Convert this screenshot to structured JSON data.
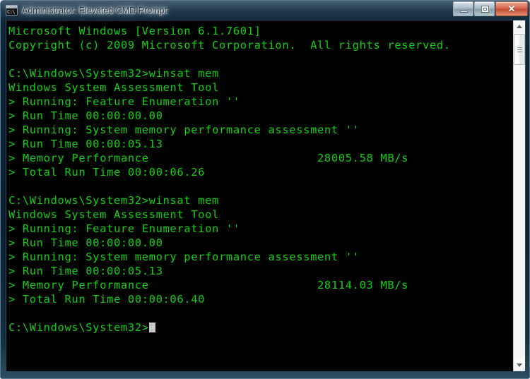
{
  "window": {
    "title": "Administrator: Elevated CMD Prompt",
    "icon": "cmd-console-icon",
    "icon_text": "C:\\",
    "colors": {
      "console_background": "#000000",
      "console_text": "#12d012",
      "titlebar": "#0a1f2e",
      "close_button": "#bf3d20",
      "cursor": "#c8c8c8"
    }
  },
  "controls": {
    "minimize_label": "–",
    "restore_label": "❐",
    "close_label": "✕"
  },
  "scrollbar": {
    "up_arrow": "scroll-up-arrow",
    "down_arrow": "scroll-down-arrow",
    "thumb": "scroll-thumb"
  },
  "console": {
    "prompt": "C:\\Windows\\System32>",
    "command": "winsat mem",
    "cursor": "█",
    "lines": [
      {
        "id": 0,
        "text": "Microsoft Windows [Version 6.1.7601]"
      },
      {
        "id": 1,
        "text": "Copyright (c) 2009 Microsoft Corporation.  All rights reserved."
      },
      {
        "id": 2,
        "text": ""
      },
      {
        "id": 3,
        "text": "C:\\Windows\\System32>winsat mem"
      },
      {
        "id": 4,
        "text": "Windows System Assessment Tool"
      },
      {
        "id": 5,
        "text": "> Running: Feature Enumeration ''"
      },
      {
        "id": 6,
        "text": "> Run Time 00:00:00.00"
      },
      {
        "id": 7,
        "text": "> Running: System memory performance assessment ''"
      },
      {
        "id": 8,
        "text": "> Run Time 00:00:05.13"
      },
      {
        "id": 9,
        "text": "> Memory Performance                        28005.58 MB/s"
      },
      {
        "id": 10,
        "text": "> Total Run Time 00:00:06.26"
      },
      {
        "id": 11,
        "text": ""
      },
      {
        "id": 12,
        "text": "C:\\Windows\\System32>winsat mem"
      },
      {
        "id": 13,
        "text": "Windows System Assessment Tool"
      },
      {
        "id": 14,
        "text": "> Running: Feature Enumeration ''"
      },
      {
        "id": 15,
        "text": "> Run Time 00:00:00.00"
      },
      {
        "id": 16,
        "text": "> Running: System memory performance assessment ''"
      },
      {
        "id": 17,
        "text": "> Run Time 00:00:05.13"
      },
      {
        "id": 18,
        "text": "> Memory Performance                        28114.03 MB/s"
      },
      {
        "id": 19,
        "text": "> Total Run Time 00:00:06.40"
      },
      {
        "id": 20,
        "text": ""
      },
      {
        "id": 21,
        "text": "C:\\Windows\\System32>"
      }
    ],
    "results": [
      {
        "run": 1,
        "tool": "Windows System Assessment Tool",
        "command": "winsat mem",
        "feature_enumeration_run_time": "00:00:00.00",
        "memory_assessment_run_time": "00:00:05.13",
        "memory_performance": "28005.58",
        "memory_performance_unit": "MB/s",
        "total_run_time": "00:00:06.26"
      },
      {
        "run": 2,
        "tool": "Windows System Assessment Tool",
        "command": "winsat mem",
        "feature_enumeration_run_time": "00:00:00.00",
        "memory_assessment_run_time": "00:00:05.13",
        "memory_performance": "28114.03",
        "memory_performance_unit": "MB/s",
        "total_run_time": "00:00:06.40"
      }
    ]
  }
}
